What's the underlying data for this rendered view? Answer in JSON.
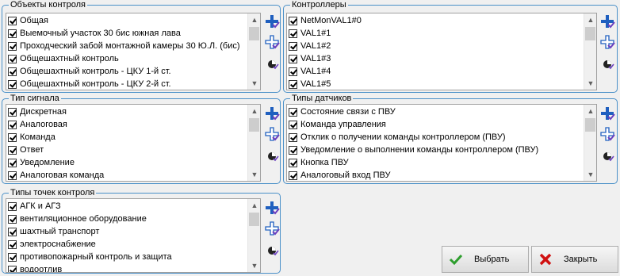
{
  "groups": {
    "control_objects": {
      "title": "Объекты контроля",
      "items": [
        "Общая",
        "Выемочный участок 30 бис южная лава",
        "Проходческий забой монтажной камеры 30 Ю.Л. (бис)",
        "Общешахтный контроль",
        "Общешахтный контроль - ЦКУ 1-й ст.",
        "Общешахтный контроль - ЦКУ 2-й ст."
      ]
    },
    "controllers": {
      "title": "Контроллеры",
      "items": [
        "NetMonVAL1#0",
        "VAL1#1",
        "VAL1#2",
        "VAL1#3",
        "VAL1#4",
        "VAL1#5"
      ]
    },
    "signal_types": {
      "title": "Тип сигнала",
      "items": [
        "Дискретная",
        "Аналоговая",
        "Команда",
        "Ответ",
        "Уведомление",
        "Аналоговая команда"
      ]
    },
    "sensor_types": {
      "title": "Типы датчиков",
      "items": [
        "Состояние связи с ПВУ",
        "Команда управления",
        "Отклик о получении команды контроллером (ПВУ)",
        "Уведомление о выполнении команды контроллером (ПВУ)",
        "Кнопка ПВУ",
        "Аналоговый вход ПВУ"
      ]
    },
    "control_point_types": {
      "title": "Типы точек контроля",
      "items": [
        "АГК и АГЗ",
        "вентиляционное оборудование",
        "шахтный транспорт",
        "электроснабжение",
        "противопожарный контроль и защита",
        "водоотлив"
      ]
    }
  },
  "icons": {
    "select_all": "plus-check-icon",
    "select_more": "plus-outline-icon",
    "invert": "invert-selection-icon",
    "scroll_up": "▲",
    "scroll_down": "▼"
  },
  "buttons": {
    "select_label": "Выбрать",
    "close_label": "Закрыть"
  },
  "colors": {
    "group_border": "#4a90c8",
    "icon_blue": "#1f5fbf",
    "check_green": "#2e9e2e",
    "close_red": "#d01010"
  }
}
